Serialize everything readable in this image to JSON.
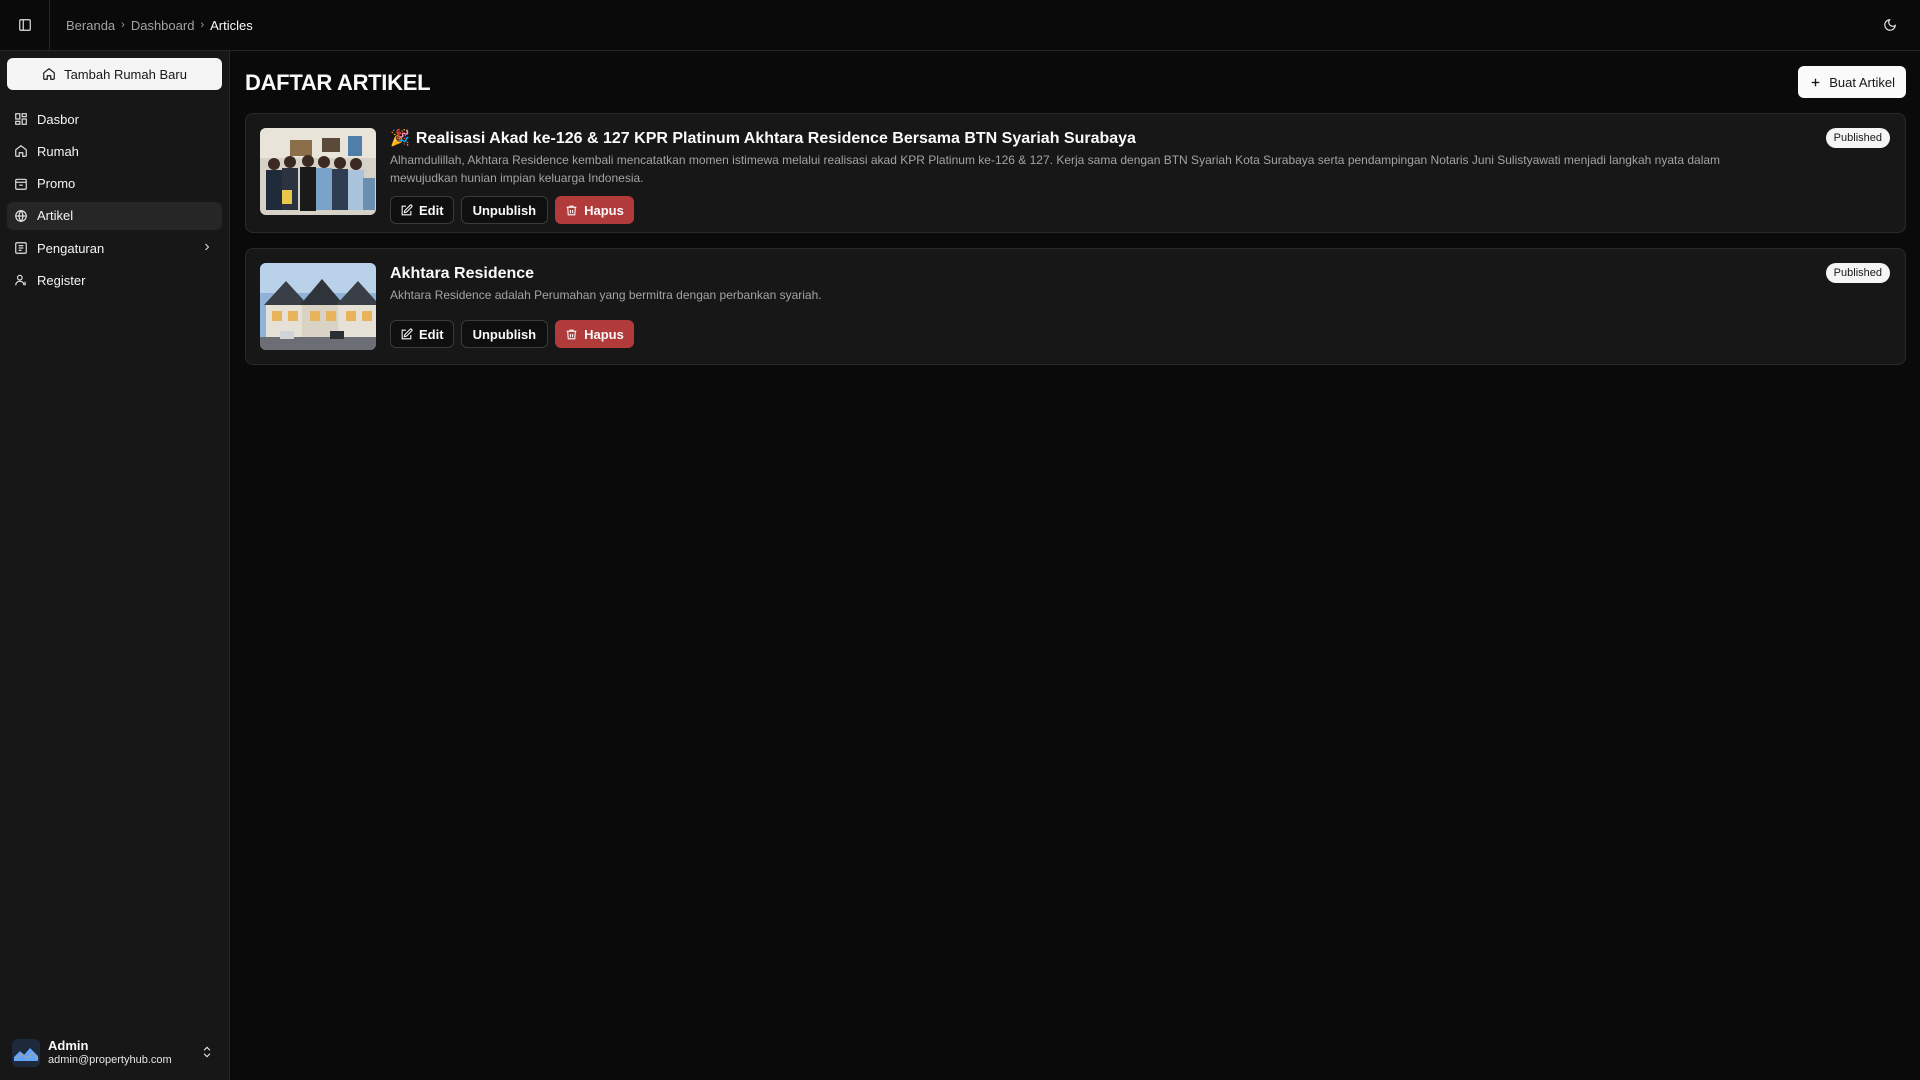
{
  "header": {
    "breadcrumb": [
      "Beranda",
      "Dashboard",
      "Articles"
    ]
  },
  "sidebar": {
    "new_house_label": "Tambah Rumah Baru",
    "items": [
      {
        "label": "Dasbor",
        "icon": "dashboard-icon"
      },
      {
        "label": "Rumah",
        "icon": "home-icon"
      },
      {
        "label": "Promo",
        "icon": "promo-icon"
      },
      {
        "label": "Artikel",
        "icon": "globe-icon",
        "active": true
      },
      {
        "label": "Pengaturan",
        "icon": "settings-icon"
      },
      {
        "label": "Register",
        "icon": "user-icon"
      }
    ],
    "user": {
      "name": "Admin",
      "email": "admin@propertyhub.com"
    }
  },
  "main": {
    "title": "DAFTAR ARTIKEL",
    "create_label": "Buat Artikel",
    "articles": [
      {
        "emoji": "🎉",
        "title": "Realisasi Akad ke-126 & 127 KPR Platinum Akhtara Residence Bersama BTN Syariah Surabaya",
        "description": "Alhamdulillah, Akhtara Residence kembali mencatatkan momen istimewa melalui realisasi akad KPR Platinum ke-126 & 127. Kerja sama dengan BTN Syariah Kota Surabaya serta pendampingan Notaris Juni Sulistyawati menjadi langkah nyata dalam mewujudkan hunian impian keluarga Indonesia.",
        "status": "Published"
      },
      {
        "emoji": "",
        "title": "Akhtara Residence",
        "description": "Akhtara Residence adalah Perumahan yang bermitra dengan perbankan syariah.",
        "status": "Published"
      }
    ],
    "actions": {
      "edit": "Edit",
      "unpublish": "Unpublish",
      "delete": "Hapus"
    }
  },
  "colors": {
    "danger": "#b13a3a",
    "background": "#0a0a0a",
    "sidebar": "#171717"
  }
}
